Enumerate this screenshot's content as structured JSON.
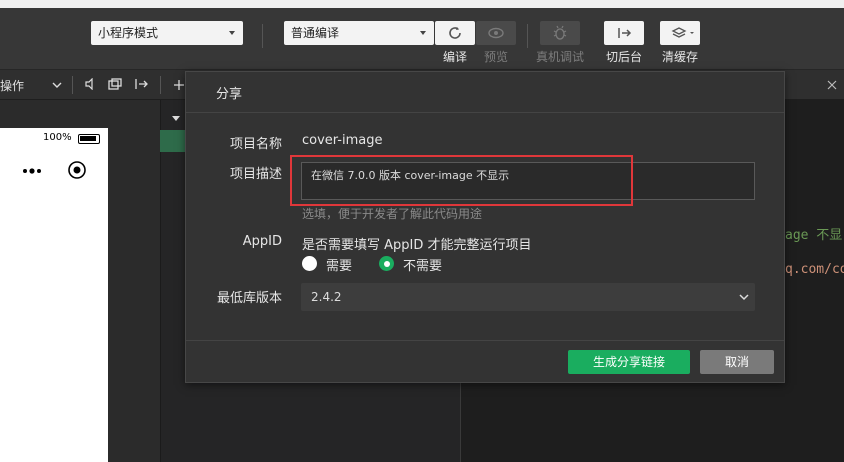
{
  "toolbar": {
    "mode_select": "小程序模式",
    "compile_select": "普通编译",
    "buttons": [
      {
        "label": "编译",
        "icon": "refresh-icon",
        "enabled": true
      },
      {
        "label": "预览",
        "icon": "eye-icon",
        "enabled": false
      },
      {
        "label": "真机调试",
        "icon": "bug-icon",
        "enabled": false
      },
      {
        "label": "切后台",
        "icon": "switch-background-icon",
        "enabled": true
      },
      {
        "label": "清缓存",
        "icon": "layers-icon",
        "enabled": true
      }
    ]
  },
  "subbar": {
    "operation_label": "操作"
  },
  "simulator": {
    "battery_percent": "100%"
  },
  "editor": {
    "code_line_1": "age 不显",
    "code_line_2": "q.com/co"
  },
  "dialog": {
    "title": "分享",
    "project_name_label": "项目名称",
    "project_name_value": "cover-image",
    "project_desc_label": "项目描述",
    "project_desc_value": "在微信 7.0.0 版本 cover-image 不显示",
    "project_desc_hint": "选填，便于开发者了解此代码用途",
    "appid_label": "AppID",
    "appid_question": "是否需要填写 AppID 才能完整运行项目",
    "appid_options": [
      {
        "label": "需要",
        "checked": false
      },
      {
        "label": "不需要",
        "checked": true
      }
    ],
    "min_version_label": "最低库版本",
    "min_version_value": "2.4.2",
    "generate_button": "生成分享链接",
    "cancel_button": "取消"
  },
  "colors": {
    "accent_green": "#1aad5f",
    "highlight_red": "#e0373a",
    "dialog_bg": "#333333"
  }
}
